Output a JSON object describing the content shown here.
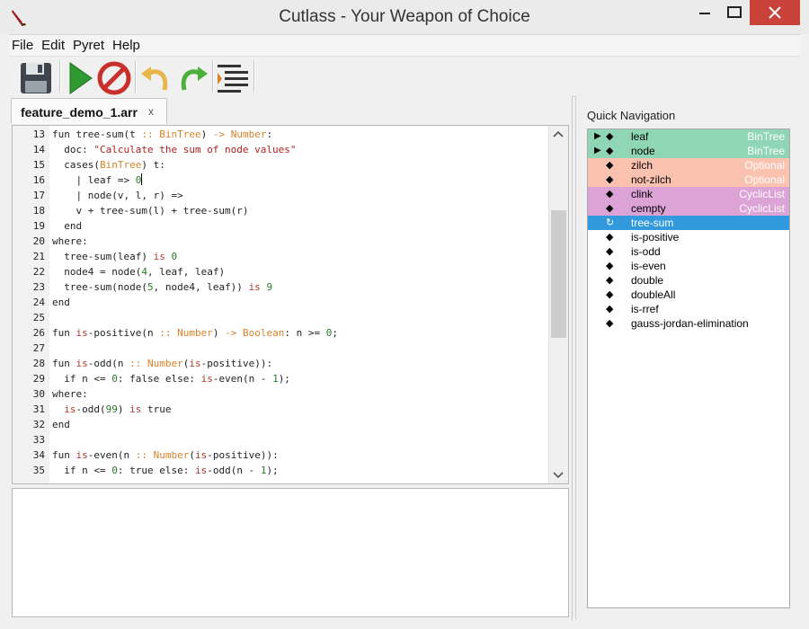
{
  "window": {
    "title": "Cutlass - Your Weapon of Choice"
  },
  "menu": {
    "items": [
      "File",
      "Edit",
      "Pyret",
      "Help"
    ]
  },
  "toolbar": {
    "buttons": [
      {
        "name": "save-button",
        "icon": "floppy-disk-icon"
      },
      {
        "name": "run-button",
        "icon": "play-icon"
      },
      {
        "name": "stop-button",
        "icon": "stop-icon"
      },
      {
        "name": "undo-button",
        "icon": "undo-icon"
      },
      {
        "name": "redo-button",
        "icon": "redo-icon"
      },
      {
        "name": "format-button",
        "icon": "indent-icon"
      }
    ]
  },
  "editor": {
    "tab": {
      "label": "feature_demo_1.arr",
      "close": "x"
    },
    "lines": [
      {
        "n": "13",
        "code": "fun tree-sum(t :: BinTree) -> Number:"
      },
      {
        "n": "14",
        "code": "  doc: \"Calculate the sum of node values\""
      },
      {
        "n": "15",
        "code": "  cases(BinTree) t:"
      },
      {
        "n": "16",
        "code": "    | leaf => 0"
      },
      {
        "n": "17",
        "code": "    | node(v, l, r) =>"
      },
      {
        "n": "18",
        "code": "    v + tree-sum(l) + tree-sum(r)"
      },
      {
        "n": "19",
        "code": "  end"
      },
      {
        "n": "20",
        "code": "where:"
      },
      {
        "n": "21",
        "code": "  tree-sum(leaf) is 0"
      },
      {
        "n": "22",
        "code": "  node4 = node(4, leaf, leaf)"
      },
      {
        "n": "23",
        "code": "  tree-sum(node(5, node4, leaf)) is 9"
      },
      {
        "n": "24",
        "code": "end"
      },
      {
        "n": "25",
        "code": ""
      },
      {
        "n": "26",
        "code": "fun is-positive(n :: Number) -> Boolean: n >= 0;"
      },
      {
        "n": "27",
        "code": ""
      },
      {
        "n": "28",
        "code": "fun is-odd(n :: Number(is-positive)):"
      },
      {
        "n": "29",
        "code": "  if n <= 0: false else: is-even(n - 1);"
      },
      {
        "n": "30",
        "code": "where:"
      },
      {
        "n": "31",
        "code": "  is-odd(99) is true"
      },
      {
        "n": "32",
        "code": "end"
      },
      {
        "n": "33",
        "code": ""
      },
      {
        "n": "34",
        "code": "fun is-even(n :: Number(is-positive)):"
      },
      {
        "n": "35",
        "code": "  if n <= 0: true else: is-odd(n - 1);"
      }
    ]
  },
  "output": {
    "text": ""
  },
  "quick_nav": {
    "title": "Quick Navigation",
    "items": [
      {
        "name": "leaf",
        "type": "BinTree",
        "bg": "#8fd7b4",
        "arrow": "▶",
        "bullet": "◆"
      },
      {
        "name": "node",
        "type": "BinTree",
        "bg": "#8fd7b4",
        "arrow": "▶",
        "bullet": "◆"
      },
      {
        "name": "zilch",
        "type": "Optional",
        "bg": "#fbc2b0",
        "arrow": "",
        "bullet": "◆"
      },
      {
        "name": "not-zilch",
        "type": "Optional",
        "bg": "#fbc2b0",
        "arrow": "",
        "bullet": "◆"
      },
      {
        "name": "clink",
        "type": "CyclicList",
        "bg": "#dca3d6",
        "arrow": "",
        "bullet": "◆"
      },
      {
        "name": "cempty",
        "type": "CyclicList",
        "bg": "#dca3d6",
        "arrow": "",
        "bullet": "◆"
      },
      {
        "name": "tree-sum",
        "type": "",
        "bg": "#3399dd",
        "arrow": "",
        "bullet": "↻",
        "selected": true
      },
      {
        "name": "is-positive",
        "type": "",
        "bg": "#ffffff",
        "arrow": "",
        "bullet": "◆"
      },
      {
        "name": "is-odd",
        "type": "",
        "bg": "#ffffff",
        "arrow": "",
        "bullet": "◆"
      },
      {
        "name": "is-even",
        "type": "",
        "bg": "#ffffff",
        "arrow": "",
        "bullet": "◆"
      },
      {
        "name": "double",
        "type": "",
        "bg": "#ffffff",
        "arrow": "",
        "bullet": "◆"
      },
      {
        "name": "doubleAll",
        "type": "",
        "bg": "#ffffff",
        "arrow": "",
        "bullet": "◆"
      },
      {
        "name": "is-rref",
        "type": "",
        "bg": "#ffffff",
        "arrow": "",
        "bullet": "◆"
      },
      {
        "name": "gauss-jordan-elimination",
        "type": "",
        "bg": "#ffffff",
        "arrow": "",
        "bullet": "◆"
      }
    ]
  }
}
